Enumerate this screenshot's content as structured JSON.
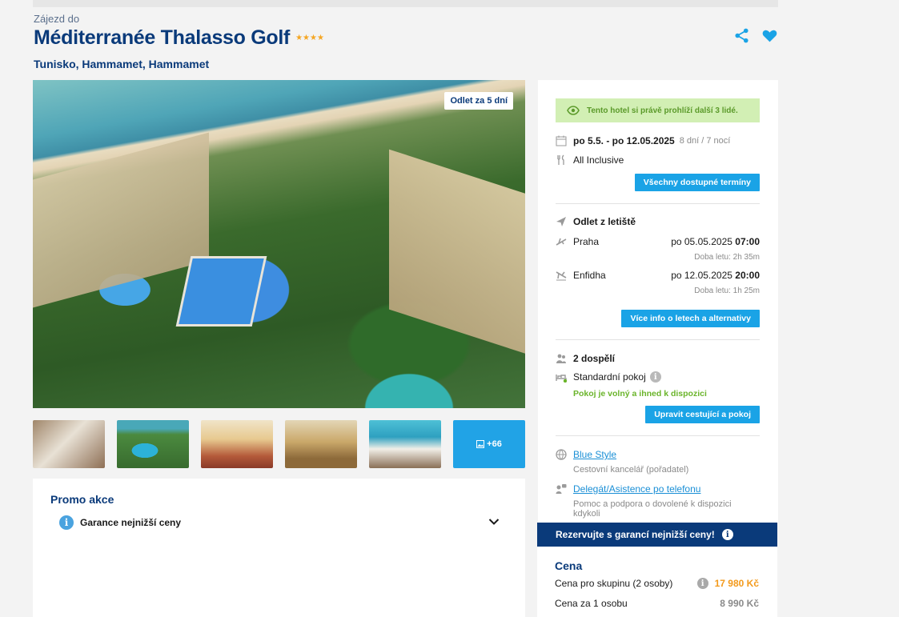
{
  "header": {
    "kicker": "Zájezd do",
    "title": "Méditerranée Thalasso Golf",
    "stars": "★★★★",
    "location": "Tunisko, Hammamet, Hammamet"
  },
  "gallery": {
    "badge": "Odlet za 5 dní",
    "more_count": "+66"
  },
  "promo": {
    "title": "Promo akce",
    "item": "Garance nejnižší ceny"
  },
  "booking": {
    "viewers_note": "Tento hotel si právě prohlíží další 3 lidé.",
    "dates": "po 5.5. - po 12.05.2025",
    "duration": "8 dní / 7 nocí",
    "board": "All Inclusive",
    "all_dates_button": "Všechny dostupné termíny",
    "departure_heading": "Odlet z letiště",
    "outbound": {
      "airport": "Praha",
      "date": "po 05.05.2025",
      "time": "07:00",
      "duration": "Doba letu: 2h 35m"
    },
    "inbound": {
      "airport": "Enfidha",
      "date": "po 12.05.2025",
      "time": "20:00",
      "duration": "Doba letu: 1h 25m"
    },
    "flights_button": "Více info o letech a alternativy",
    "travellers": "2 dospělí",
    "room": "Standardní pokoj",
    "room_status": "Pokoj je volný a ihned k dispozici",
    "edit_button": "Upravit cestující a pokoj",
    "organizer_name": "Blue Style",
    "organizer_desc": "Cestovní kancelář (pořadatel)",
    "support_name": "Delegát/Asistence po telefonu",
    "support_desc": "Pomoc a podpora o dovolené k dispozici kdykoli"
  },
  "cta": {
    "label": "Rezervujte s garancí nejnižší ceny!"
  },
  "price": {
    "title": "Cena",
    "group_label": "Cena pro skupinu (2 osoby)",
    "group_value": "17 980 Kč",
    "person_label": "Cena za 1 osobu",
    "person_value": "8 990 Kč"
  },
  "colors": {
    "brand": "#0a3a7a",
    "accent": "#1aa3e6",
    "favorite": "#1aa3e6",
    "price": "#f39a1c",
    "available": "#6ab42a"
  }
}
